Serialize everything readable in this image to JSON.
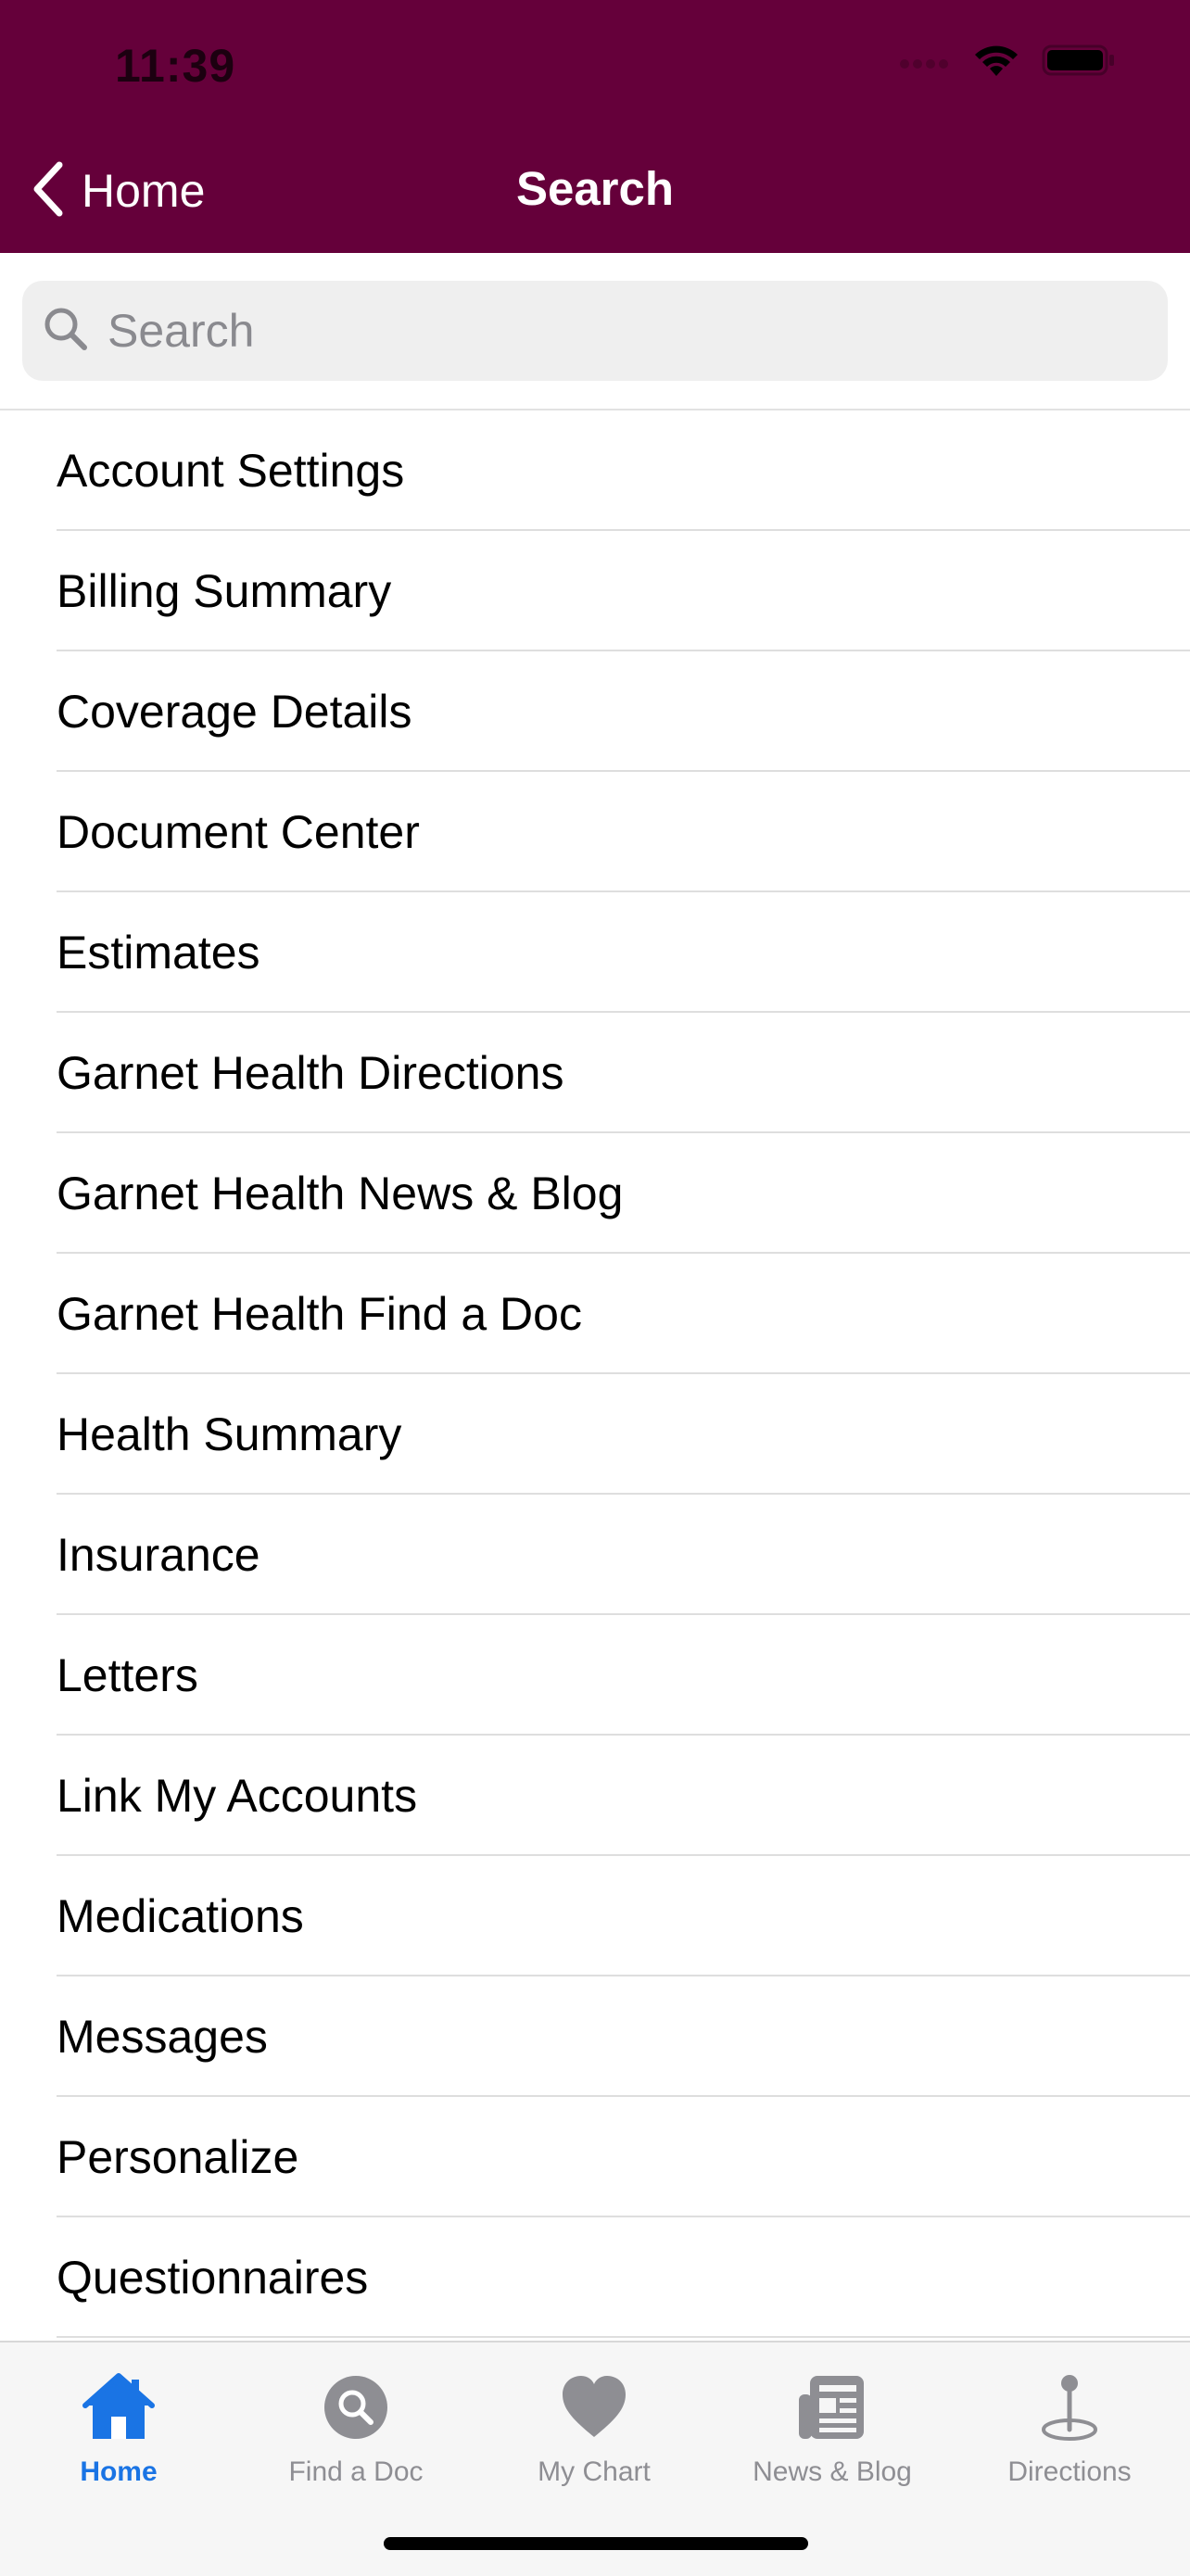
{
  "status_bar": {
    "time": "11:39",
    "icons": [
      "signal-icon",
      "wifi-icon",
      "battery-icon"
    ]
  },
  "nav": {
    "back_label": "Home",
    "title": "Search"
  },
  "search": {
    "placeholder": "Search",
    "value": ""
  },
  "items": [
    {
      "label": "Account Settings"
    },
    {
      "label": "Billing Summary"
    },
    {
      "label": "Coverage Details"
    },
    {
      "label": "Document Center"
    },
    {
      "label": "Estimates"
    },
    {
      "label": "Garnet Health Directions"
    },
    {
      "label": "Garnet Health News & Blog"
    },
    {
      "label": "Garnet Health Find a Doc"
    },
    {
      "label": "Health Summary"
    },
    {
      "label": "Insurance"
    },
    {
      "label": "Letters"
    },
    {
      "label": "Link My Accounts"
    },
    {
      "label": "Medications"
    },
    {
      "label": "Messages"
    },
    {
      "label": "Personalize"
    },
    {
      "label": "Questionnaires"
    }
  ],
  "tabs": [
    {
      "label": "Home",
      "icon": "house-icon",
      "active": true
    },
    {
      "label": "Find a Doc",
      "icon": "search-circle-icon",
      "active": false
    },
    {
      "label": "My Chart",
      "icon": "heart-icon",
      "active": false
    },
    {
      "label": "News & Blog",
      "icon": "newspaper-icon",
      "active": false
    },
    {
      "label": "Directions",
      "icon": "map-pin-icon",
      "active": false
    }
  ],
  "colors": {
    "header": "#65003a",
    "tab_active": "#1a74e4",
    "tab_inactive": "#8e8e93"
  }
}
